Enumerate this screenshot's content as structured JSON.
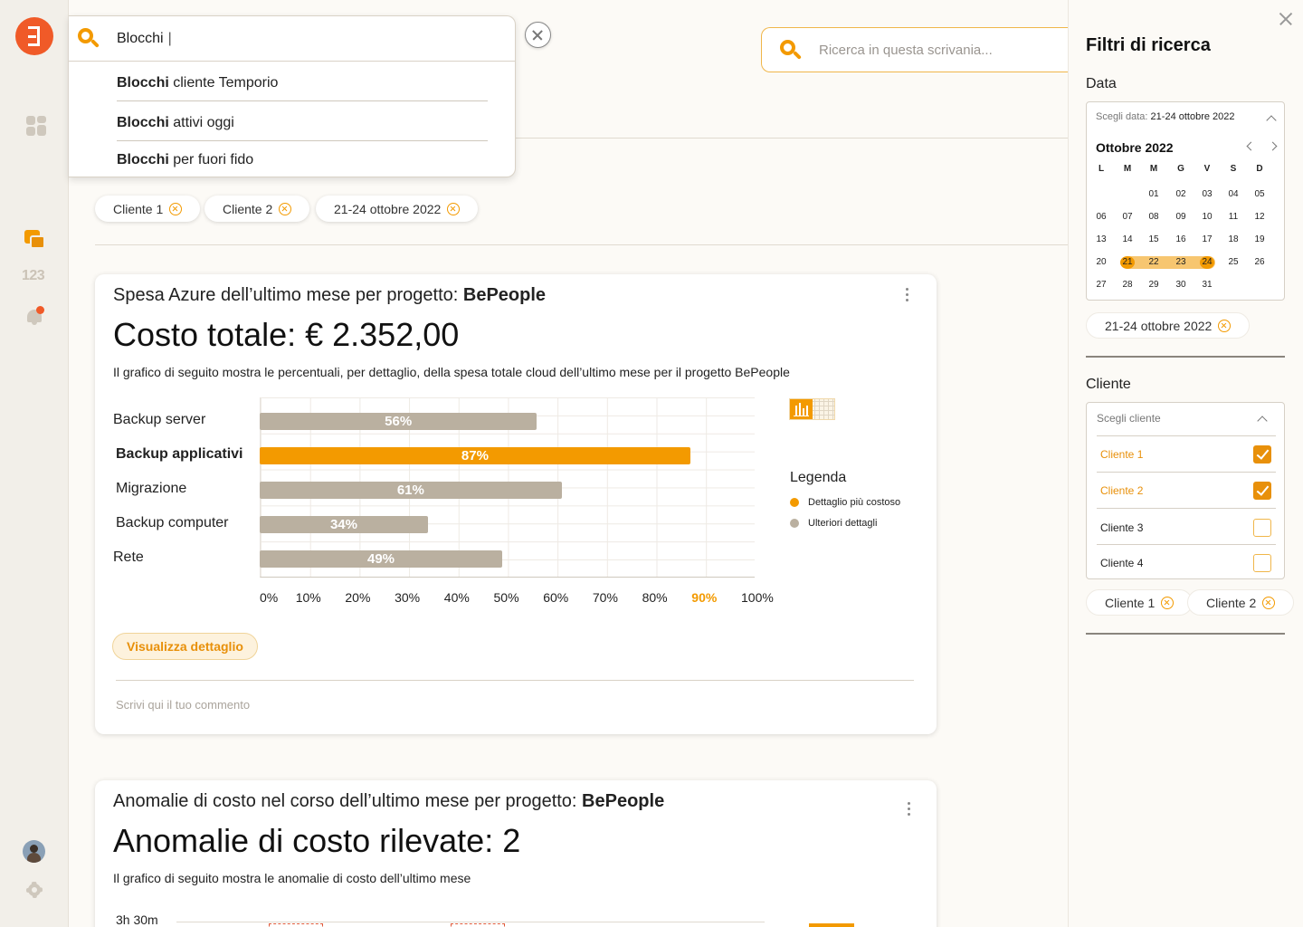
{
  "search": {
    "query": "Blocchi",
    "suggestions": [
      {
        "bold": "Blocchi",
        "rest": " cliente Temporio"
      },
      {
        "bold": "Blocchi",
        "rest": " attivi oggi"
      },
      {
        "bold": "Blocchi",
        "rest": " per fuori fido"
      }
    ]
  },
  "desk_search": {
    "placeholder": "Ricerca in questa scrivania..."
  },
  "active_filters": [
    "Cliente 1",
    "Cliente 2",
    "21-24 ottobre 2022"
  ],
  "sidebar": {
    "counter_label": "123"
  },
  "card1": {
    "subtitle": "Spesa Azure dell’ultimo mese per progetto: ",
    "project": "BePeople",
    "title": "Costo totale: € 2.352,00",
    "description": "Il grafico di seguito mostra le percentuali, per dettaglio, della spesa totale cloud dell’ultimo mese per il progetto BePeople",
    "legend_title": "Legenda",
    "legend": [
      {
        "label": "Dettaglio più costoso",
        "color": "#f39a00"
      },
      {
        "label": "Ulteriori dettagli",
        "color": "#bab0a0"
      }
    ],
    "detail_button": "Visualizza dettaglio",
    "comment_placeholder": "Scrivi qui il tuo commento"
  },
  "chart_data": {
    "type": "bar",
    "orientation": "horizontal",
    "categories": [
      "Backup server",
      "Backup applicativi",
      "Migrazione",
      "Backup computer",
      "Rete"
    ],
    "values": [
      56,
      87,
      61,
      34,
      49
    ],
    "value_labels": [
      "56%",
      "87%",
      "61%",
      "34%",
      "49%"
    ],
    "highlight_index": 1,
    "xlim": [
      0,
      100
    ],
    "x_ticks": [
      "0%",
      "10%",
      "20%",
      "30%",
      "40%",
      "50%",
      "60%",
      "70%",
      "80%",
      "90%",
      "100%"
    ],
    "highlight_tick": "90%",
    "colors": {
      "highlight": "#f39a00",
      "default": "#bab0a0"
    },
    "grid": true
  },
  "card2": {
    "subtitle": "Anomalie di costo nel corso dell’ultimo mese per progetto: ",
    "project": "BePeople",
    "title": "Anomalie di costo rilevate: 2",
    "description": "Il grafico di seguito mostra le anomalie di costo dell’ultimo mese",
    "y_first_tick": "3h 30m"
  },
  "panel": {
    "title": "Filtri di ricerca",
    "date_label": "Data",
    "date_choose_prefix": "Scegli data: ",
    "date_choose_value": "21-24 ottobre 2022",
    "month": "Ottobre 2022",
    "weekdays": [
      "L",
      "M",
      "M",
      "G",
      "V",
      "S",
      "D"
    ],
    "weeks": [
      [
        "",
        "",
        "01",
        "02",
        "03",
        "04",
        "05"
      ],
      [
        "06",
        "07",
        "08",
        "09",
        "10",
        "11",
        "12"
      ],
      [
        "13",
        "14",
        "15",
        "16",
        "17",
        "18",
        "19"
      ],
      [
        "20",
        "21",
        "22",
        "23",
        "24",
        "25",
        "26"
      ],
      [
        "27",
        "28",
        "29",
        "30",
        "31",
        "",
        ""
      ]
    ],
    "date_chip": "21-24 ottobre 2022",
    "client_label": "Cliente",
    "client_placeholder": "Scegli cliente",
    "clients": [
      {
        "label": "Cliente 1",
        "checked": true
      },
      {
        "label": "Cliente 2",
        "checked": true
      },
      {
        "label": "Cliente 3",
        "checked": false
      },
      {
        "label": "Cliente 4",
        "checked": false
      }
    ],
    "client_chips": [
      "Cliente 1",
      "Cliente 2"
    ]
  },
  "colors": {
    "accent": "#f39a00",
    "brand": "#f05a28"
  }
}
